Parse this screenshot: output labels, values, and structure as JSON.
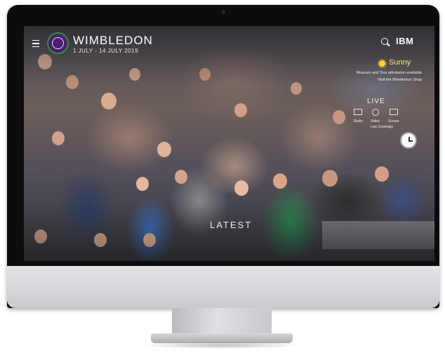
{
  "header": {
    "title": "WIMBLEDON",
    "dates": "1 JULY - 14 JULY 2019",
    "brand": "IBM"
  },
  "weather": {
    "condition": "Sunny",
    "notice": "Museum and Tour admission available",
    "shop_link": "Visit the Wimbledon Shop"
  },
  "live": {
    "label": "LIVE",
    "captions": [
      "Radio",
      "Video",
      "Scores"
    ],
    "extra": "Live Coverage"
  },
  "content": {
    "latest_label": "LATEST"
  },
  "icons": {
    "menu": "menu-icon",
    "logo": "wimbledon-logo",
    "search": "search-icon",
    "weather": "sun-icon",
    "clock": "clock-icon"
  },
  "colors": {
    "brand_purple": "#4b1e6e",
    "brand_green": "#3a8b3e",
    "weather_text": "#ffe680"
  }
}
